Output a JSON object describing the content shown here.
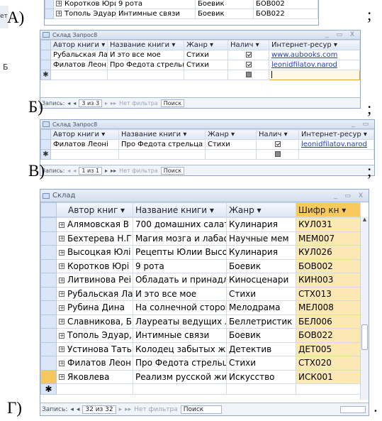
{
  "labels": {
    "a": "А)",
    "b": "Б)",
    "v": "В)",
    "g": "Г)",
    "semi": ";",
    "dot": "."
  },
  "top_rows": [
    [
      "Коротков Юри",
      "9 рота",
      "Боевик",
      "БОВ002"
    ],
    [
      "Тополь Эдуард",
      "Интимные связи",
      "Боевик",
      "БОВ022"
    ]
  ],
  "side_letter": "Б",
  "q1": {
    "title": "Склад Запрос8",
    "controls": "_ ▭ X",
    "headers": [
      "Автор книги ▾",
      "Название книги ▾",
      "Жанр ▾",
      "Налич ▾",
      "Интернет-ресур ▾"
    ],
    "rows": [
      [
        "Рубальская Ла",
        "И это все мое",
        "Стихи",
        true,
        "www.aubooks.com"
      ],
      [
        "Филатов Леоні",
        "Про Федота стрельца",
        "Стихи",
        true,
        "leonidfilatov.narod"
      ]
    ],
    "nav": {
      "label": "Запись:",
      "first": "◂",
      "prev": "◂",
      "pos": "3 из 3",
      "next": "▸",
      "last": "▸▸",
      "filter": "Нет фильтра",
      "search": "Поиск"
    }
  },
  "q2": {
    "title": "Склад Запрос8",
    "controls": "_ ▭",
    "headers": [
      "Автор книги ▾",
      "Название книги ▾",
      "Жанр ▾",
      "Налич ▾",
      "Интернет-ресур ▾"
    ],
    "rows": [
      [
        "Филатов Леоні",
        "Про Федота стрельца",
        "Стихи",
        true,
        "leonidfilatov.narod"
      ]
    ],
    "nav": {
      "label": "Запись:",
      "first": "◂",
      "prev": "◂",
      "pos": "1 из 1",
      "next": "▸",
      "last": "▸▸",
      "filter": "Нет фильтра",
      "search": "Поиск"
    }
  },
  "t": {
    "title": "Склад",
    "controls": "_ ▭ X",
    "headers": [
      "Автор книг ▾",
      "Название книги ▾",
      "Жанр ▾",
      "Шифр кн ▾"
    ],
    "rows": [
      [
        "Алямовская В",
        "700 домашних салатс",
        "Кулинария",
        "КУЛ031"
      ],
      [
        "Бехтерева Н.Г",
        "Магия мозга и лабаоі",
        "Научные мем",
        "МЕМ007"
      ],
      [
        "Высоцкая Юлі",
        "Рецепты Юлии Высоі",
        "Кулинария",
        "КУЛ026"
      ],
      [
        "Коротков Юрі",
        "9 рота",
        "Боевик",
        "БОВ002"
      ],
      [
        "Литвинова Реі",
        "Обладать и принадл",
        "Киносценари",
        "КИН003"
      ],
      [
        "Рубальская Ла",
        "И это все мое",
        "Стихи",
        "СТХ013"
      ],
      [
        "Рубина Дина",
        "На солнечной сторон",
        "Мелодрама",
        "МЕЛ008"
      ],
      [
        "Славникова, Б",
        "Лауреаты ведущих лі",
        "Беллетристик",
        "БЕЛ006"
      ],
      [
        "Тополь Эдуар,",
        "Интимные связи",
        "Боевик",
        "БОВ022"
      ],
      [
        "Устинова Тать",
        "Колодец забытых же",
        "Детектив",
        "ДЕТ005"
      ],
      [
        "Филатов Леон",
        "Про Федота стрельца",
        "Стихи",
        "СТХ020"
      ],
      [
        "Яковлева",
        "Реализм русской жив",
        "Искусство",
        "ИСК001"
      ]
    ],
    "nav": {
      "label": "Запись:",
      "first": "◂",
      "prev": "◂",
      "pos": "32 из 32",
      "next": "▸",
      "last": "▸▸",
      "filter": "Нет фильтра",
      "search": "Поиск"
    }
  }
}
